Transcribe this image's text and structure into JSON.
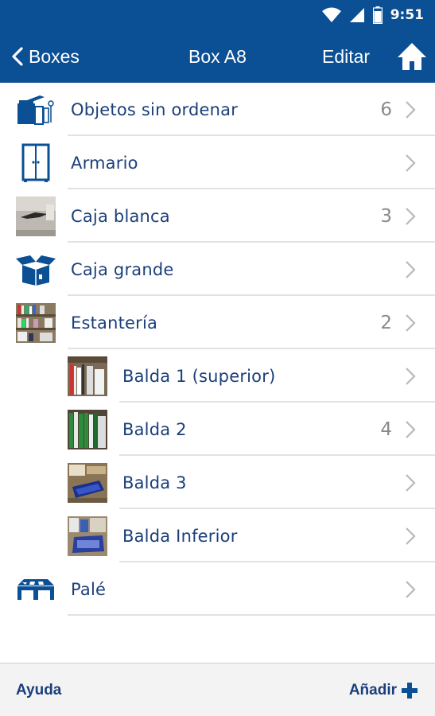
{
  "status_bar": {
    "time": "9:51",
    "icons": [
      "wifi-icon",
      "signal-icon",
      "battery-icon"
    ]
  },
  "header": {
    "back_label": "Boxes",
    "title": "Box A8",
    "edit_label": "Editar",
    "home_icon": "home-icon"
  },
  "items": [
    {
      "label": "Objetos sin ordenar",
      "count": "6",
      "icon": "unsorted-objects-icon",
      "level": 0
    },
    {
      "label": "Armario",
      "count": "",
      "icon": "wardrobe-icon",
      "level": 0
    },
    {
      "label": "Caja blanca",
      "count": "3",
      "icon": "white-box-photo",
      "level": 0
    },
    {
      "label": "Caja grande",
      "count": "",
      "icon": "open-box-icon",
      "level": 0
    },
    {
      "label": "Estantería",
      "count": "2",
      "icon": "shelving-photo",
      "level": 0
    },
    {
      "label": "Balda 1 (superior)",
      "count": "",
      "icon": "shelf-photo",
      "level": 1
    },
    {
      "label": "Balda 2",
      "count": "4",
      "icon": "shelf-photo",
      "level": 1
    },
    {
      "label": "Balda 3",
      "count": "",
      "icon": "shelf-photo",
      "level": 1
    },
    {
      "label": "Balda Inferior",
      "count": "",
      "icon": "shelf-photo",
      "level": 1
    },
    {
      "label": "Palé",
      "count": "",
      "icon": "pallet-icon",
      "level": 0
    }
  ],
  "footer": {
    "help_label": "Ayuda",
    "add_label": "Añadir"
  },
  "colors": {
    "brand": "#0b4f94",
    "text": "#1b3f7a",
    "count": "#8a8a8a"
  }
}
